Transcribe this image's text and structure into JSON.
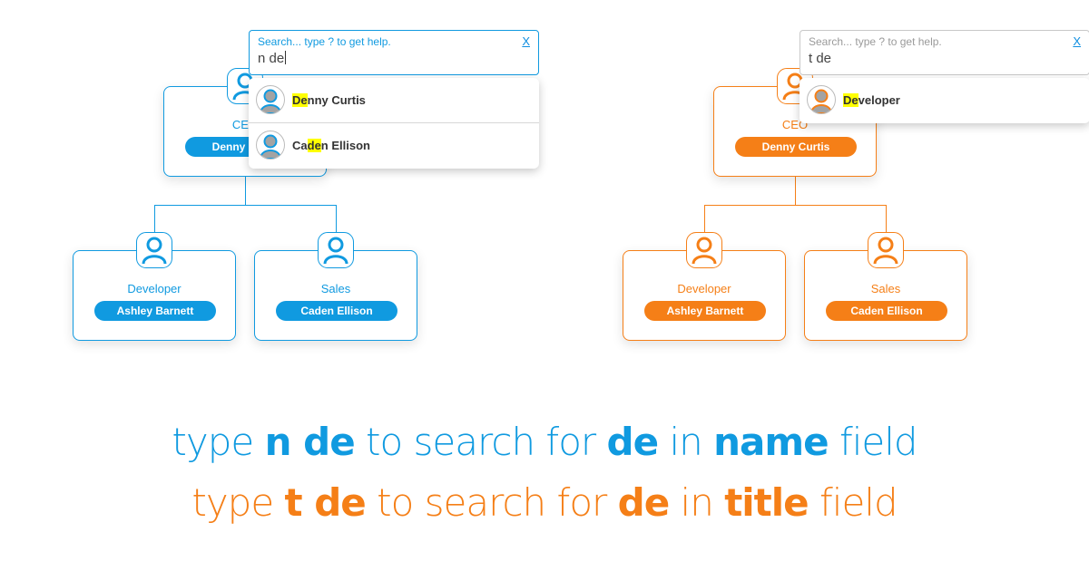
{
  "colors": {
    "blue": "#109ae0",
    "orange": "#f57f17",
    "highlight": "#ffff00"
  },
  "panels": {
    "blue": {
      "search": {
        "placeholder": "Search... type ? to get help.",
        "value": "n de",
        "close_label": "X"
      },
      "results": [
        {
          "pre": "",
          "match": "De",
          "post": "nny Curtis"
        },
        {
          "pre": "Ca",
          "match": "de",
          "post": "n Ellison"
        }
      ],
      "nodes": {
        "root": {
          "title": "CEO",
          "name": "Denny Curtis"
        },
        "left": {
          "title": "Developer",
          "name": "Ashley Barnett"
        },
        "right": {
          "title": "Sales",
          "name": "Caden Ellison"
        }
      }
    },
    "orange": {
      "search": {
        "placeholder": "Search... type ? to get help.",
        "value": "t de",
        "close_label": "X"
      },
      "results": [
        {
          "pre": "",
          "match": "De",
          "post": "veloper"
        }
      ],
      "nodes": {
        "root": {
          "title": "CEO",
          "name": "Denny Curtis"
        },
        "left": {
          "title": "Developer",
          "name": "Ashley Barnett"
        },
        "right": {
          "title": "Sales",
          "name": "Caden Ellison"
        }
      }
    }
  },
  "captions": {
    "line1": {
      "t1": "type ",
      "b1": "n de",
      "t2": " to search for ",
      "b2": "de",
      "t3": " in ",
      "b3": "name",
      "t4": " field"
    },
    "line2": {
      "t1": "type ",
      "b1": "t de",
      "t2": " to search for ",
      "b2": "de",
      "t3": " in ",
      "b3": "title",
      "t4": " field"
    }
  }
}
